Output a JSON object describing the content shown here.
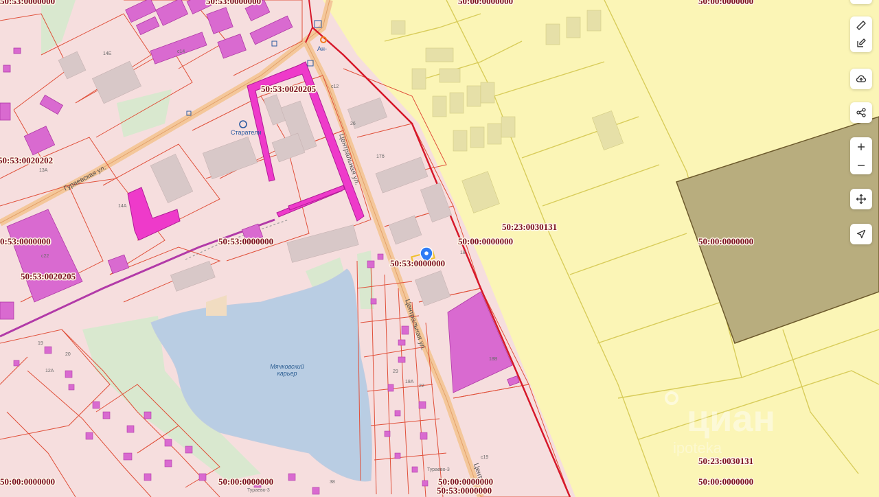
{
  "map": {
    "cadastral_labels": [
      "50:53:0000000",
      "50:00:0000000",
      "50:00:0000000",
      "50:53:0020205",
      "50:53:0020202",
      "0:53:0000000",
      "50:53:0000000",
      "50:00:0000000",
      "50:23:0030131",
      "50:00:0000000",
      "50:53:0000000",
      "50:53:0020205",
      "50:23:0030131",
      "50:00:0000000",
      "50:00:0000000",
      "50:00:0000000",
      "50:00:0000000",
      "50:53:0000000"
    ],
    "streets": [
      "Гураевская ул.",
      "Центральная ул.",
      "Центральная ул.",
      "Центр"
    ],
    "water_name_line1": "Мячковский",
    "water_name_line2": "карьер",
    "pois": [
      "Старатели",
      "Ан-"
    ],
    "building_numbers": [
      "14Е",
      "с14",
      "26",
      "с12",
      "17б",
      "с22",
      "13А",
      "14А",
      "18",
      "18В",
      "с19",
      "19",
      "20",
      "12А",
      "29",
      "18А",
      "22",
      "38",
      "Тураево-3",
      "Тураево-3"
    ],
    "watermark": "циан",
    "watermark_sub": "ipoteka"
  },
  "toolbar": {
    "ruler_icon": "ruler-icon",
    "edit_icon": "edit-icon",
    "upload_icon": "cloud-upload-icon",
    "share_icon": "share-icon",
    "zoom_in_icon": "plus-icon",
    "zoom_out_icon": "minus-icon",
    "move_icon": "move-icon",
    "locate_icon": "navigation-arrow-icon"
  },
  "colors": {
    "urban_zone": "#f6dede",
    "agricultural_zone": "#fbf5b6",
    "building": "#d96ad0",
    "highlight": "#ee3aca",
    "boundary": "#e0503a",
    "district_border": "#d6182a",
    "water": "#b9cde3",
    "olive_parcel": "#b8ad7e"
  }
}
